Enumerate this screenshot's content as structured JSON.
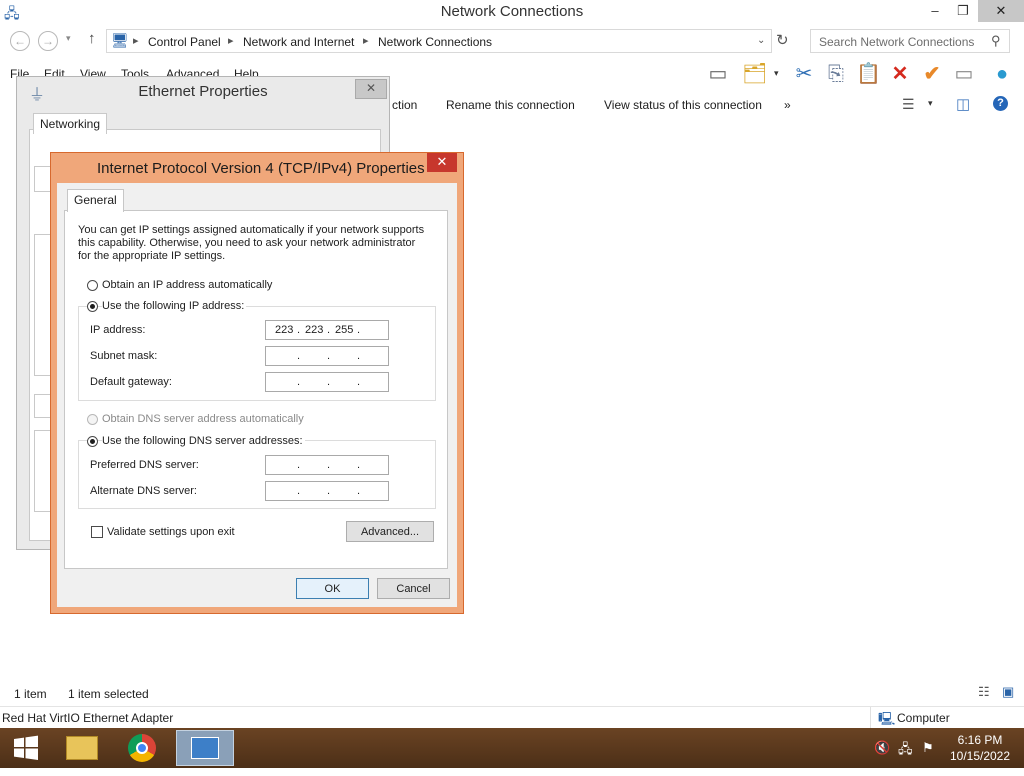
{
  "window": {
    "title": "Network Connections",
    "minimize": "–",
    "restore": "❐",
    "close": "✕"
  },
  "address": {
    "crumbs": [
      "Control Panel",
      "Network and Internet",
      "Network Connections"
    ],
    "search_placeholder": "Search Network Connections"
  },
  "menu": [
    "File",
    "Edit",
    "View",
    "Tools",
    "Advanced",
    "Help"
  ],
  "commands": {
    "partial": "ction",
    "rename": "Rename this connection",
    "view_status": "View status of this connection",
    "more": "»"
  },
  "status": {
    "items": "1 item",
    "selected": "1 item selected"
  },
  "details": {
    "adapter": "Red Hat VirtIO Ethernet Adapter",
    "computer": "Computer"
  },
  "taskbar": {
    "time": "6:16 PM",
    "date": "10/15/2022"
  },
  "ethernet_dialog": {
    "title": "Ethernet Properties",
    "tab": "Networking",
    "close": "✕"
  },
  "ipv4_dialog": {
    "title": "Internet Protocol Version 4 (TCP/IPv4) Properties",
    "close": "✕",
    "tab": "General",
    "description_lines": [
      "You can get IP settings assigned automatically if your network supports",
      "this capability. Otherwise, you need to ask your network administrator",
      "for the appropriate IP settings."
    ],
    "ip_auto_label": "Obtain an IP address automatically",
    "ip_manual_label": "Use the following IP address:",
    "ip_address_label": "IP address:",
    "ip_address_octets": [
      "223",
      "223",
      "255",
      ""
    ],
    "subnet_label": "Subnet mask:",
    "gateway_label": "Default gateway:",
    "dns_auto_label": "Obtain DNS server address automatically",
    "dns_manual_label": "Use the following DNS server addresses:",
    "preferred_dns_label": "Preferred DNS server:",
    "alternate_dns_label": "Alternate DNS server:",
    "validate_label": "Validate settings upon exit",
    "advanced_button": "Advanced...",
    "ok_button": "OK",
    "cancel_button": "Cancel",
    "selected_ip_mode": "manual",
    "selected_dns_mode": "manual",
    "validate_checked": false
  },
  "colors": {
    "dialog_frame": "#f0a77a",
    "close_red": "#c7372d",
    "taskbar": "#5b3a1e"
  }
}
